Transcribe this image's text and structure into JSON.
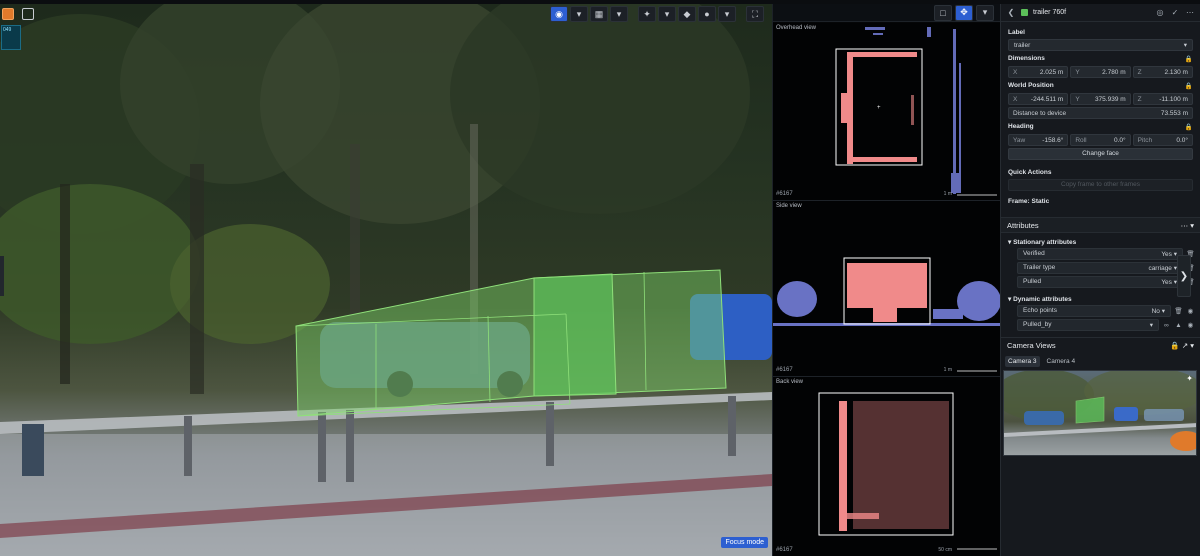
{
  "viewport": {
    "focus_mode": "Focus mode",
    "mini_label": "049"
  },
  "lidar": {
    "overhead_title": "Overhead view",
    "side_title": "Side view",
    "back_title": "Back view",
    "overhead_id": "#6167",
    "side_id": "#6167",
    "back_id": "#6167",
    "overhead_scale": "1 m",
    "side_scale": "1 m",
    "back_scale": "50 cm"
  },
  "panel": {
    "title": "trailer 760f",
    "label_heading": "Label",
    "label_value": "trailer",
    "dimensions_heading": "Dimensions",
    "dimensions": [
      {
        "k": "X",
        "v": "2.025 m"
      },
      {
        "k": "Y",
        "v": "2.780 m"
      },
      {
        "k": "Z",
        "v": "2.130 m"
      }
    ],
    "world_position_heading": "World Position",
    "world_position": [
      {
        "k": "X",
        "v": "-244.511 m"
      },
      {
        "k": "Y",
        "v": "375.939 m"
      },
      {
        "k": "Z",
        "v": "-11.100 m"
      }
    ],
    "distance_label": "Distance to device",
    "distance_value": "73.553 m",
    "heading_heading": "Heading",
    "heading": [
      {
        "k": "Yaw",
        "v": "-158.6°"
      },
      {
        "k": "Roll",
        "v": "0.0°"
      },
      {
        "k": "Pitch",
        "v": "0.0°"
      }
    ],
    "change_face": "Change face",
    "quick_actions_heading": "Quick Actions",
    "copy_frame": "Copy frame to other frames",
    "frame_static": "Frame: Static",
    "attributes_heading": "Attributes",
    "stationary_heading": "Stationary attributes",
    "stationary": [
      {
        "name": "Verified",
        "value": "Yes"
      },
      {
        "name": "Trailer type",
        "value": "carriage"
      },
      {
        "name": "Pulled",
        "value": "Yes"
      }
    ],
    "dynamic_heading": "Dynamic attributes",
    "dynamic": [
      {
        "name": "Echo points",
        "value": "No"
      },
      {
        "name": "Pulled_by",
        "value": ""
      }
    ],
    "camera_views_heading": "Camera Views",
    "camera_tabs": [
      "Camera 3",
      "Camera 4"
    ]
  },
  "colors": {
    "accent": "#2d5fd1",
    "box_green": "#5cc05a",
    "points_red": "#f08a8a",
    "points_blue": "#7c86e6"
  }
}
